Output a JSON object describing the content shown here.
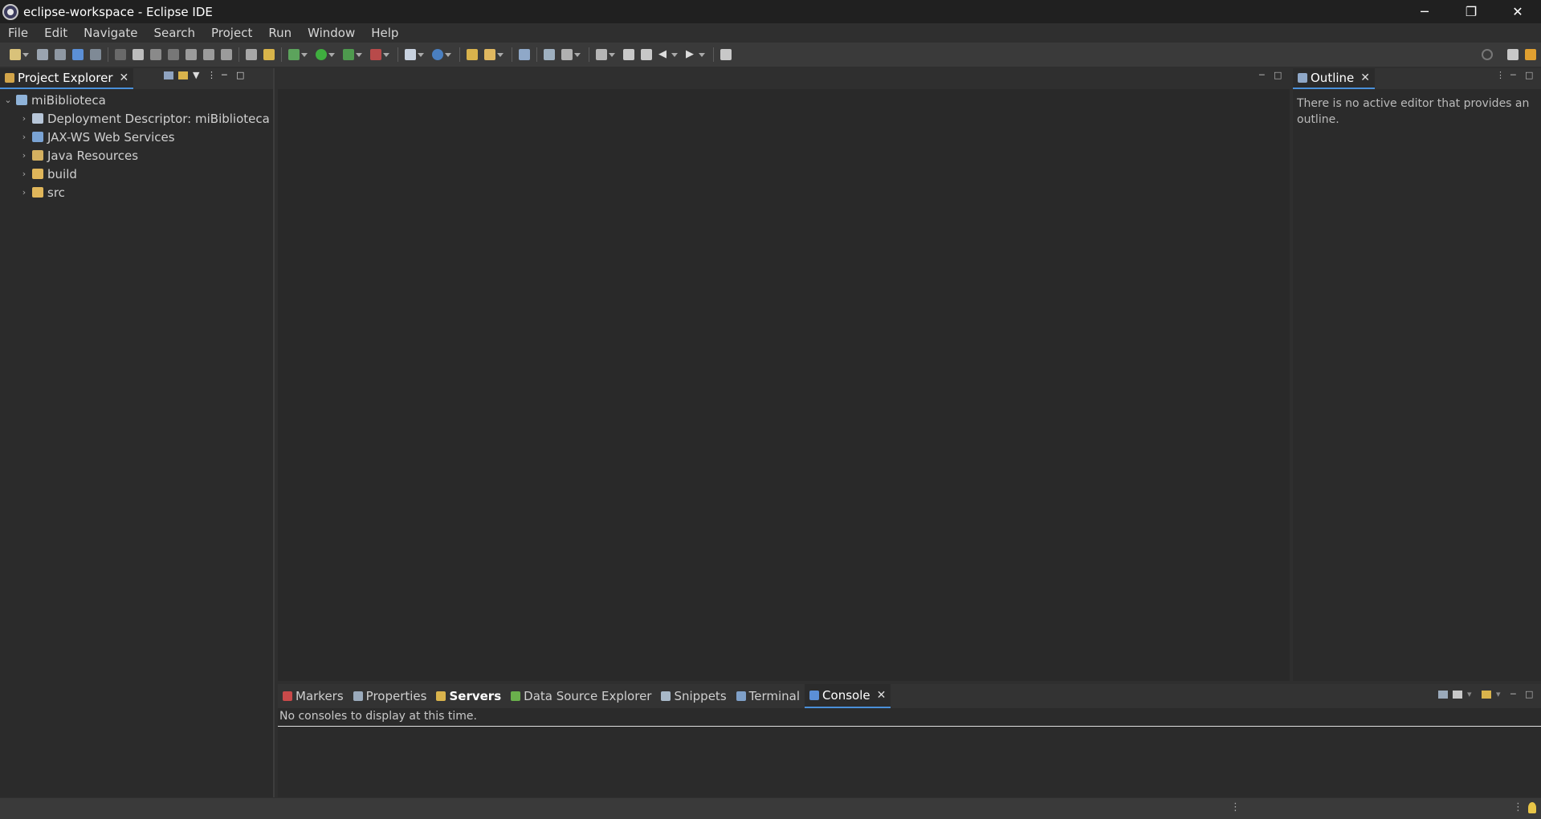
{
  "window": {
    "title": "eclipse-workspace - Eclipse IDE",
    "controls": {
      "minimize": "─",
      "restore": "❐",
      "close": "✕"
    }
  },
  "menu": [
    "File",
    "Edit",
    "Navigate",
    "Search",
    "Project",
    "Run",
    "Window",
    "Help"
  ],
  "project_explorer": {
    "tab_label": "Project Explorer",
    "root": "miBiblioteca",
    "children": [
      {
        "label": "Deployment Descriptor: miBiblioteca",
        "icon": "deployment-descriptor-icon"
      },
      {
        "label": "JAX-WS Web Services",
        "icon": "web-services-icon"
      },
      {
        "label": "Java Resources",
        "icon": "java-resources-icon"
      },
      {
        "label": "build",
        "icon": "folder-icon"
      },
      {
        "label": "src",
        "icon": "folder-icon"
      }
    ]
  },
  "outline": {
    "tab_label": "Outline",
    "message": "There is no active editor that provides an outline."
  },
  "bottom_panel": {
    "tabs": [
      {
        "label": "Markers",
        "icon": "markers-icon"
      },
      {
        "label": "Properties",
        "icon": "properties-icon"
      },
      {
        "label": "Servers",
        "icon": "servers-icon"
      },
      {
        "label": "Data Source Explorer",
        "icon": "data-source-icon"
      },
      {
        "label": "Snippets",
        "icon": "snippets-icon"
      },
      {
        "label": "Terminal",
        "icon": "terminal-icon"
      },
      {
        "label": "Console",
        "icon": "console-icon"
      }
    ],
    "active_tab": "Console",
    "console_message": "No consoles to display at this time."
  },
  "colors": {
    "accent": "#4a90d9",
    "background": "#2f2f2f",
    "editor": "#2b2b2b"
  }
}
